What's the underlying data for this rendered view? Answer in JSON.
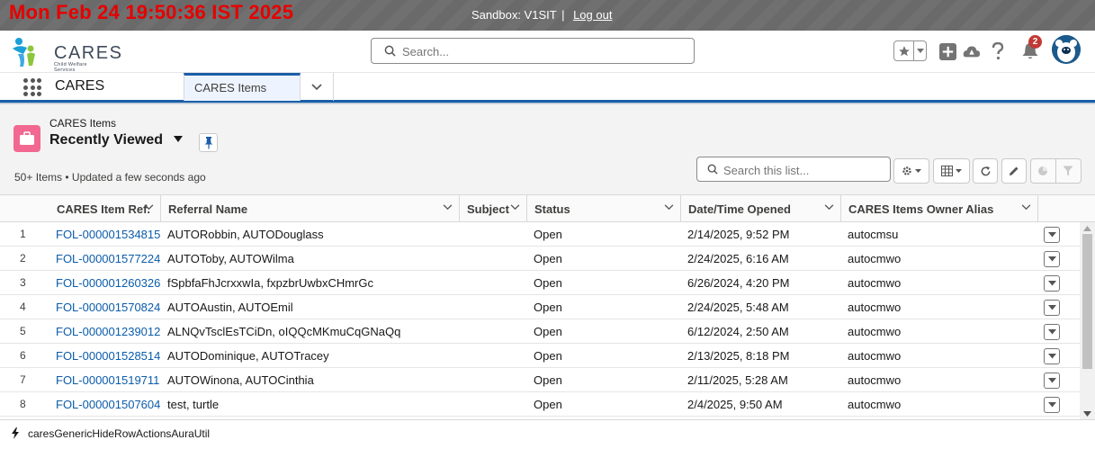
{
  "sandbox": {
    "clock": "Mon Feb 24 19:50:36 IST 2025",
    "label": "Sandbox: V1SIT",
    "separator": "|",
    "logout": "Log out"
  },
  "header": {
    "logo_text": "CARES",
    "logo_sub": "Child Welfare Services",
    "search_placeholder": "Search...",
    "notification_count": "2"
  },
  "nav": {
    "app_name": "CARES",
    "active_tab": "CARES Items"
  },
  "list_view": {
    "object_label": "CARES Items",
    "title": "Recently Viewed",
    "count_text": "50+ Items • Updated a few seconds ago",
    "search_placeholder": "Search this list..."
  },
  "table": {
    "columns": [
      "CARES Item Ref.",
      "Referral Name",
      "Subject",
      "Status",
      "Date/Time Opened",
      "CARES Items Owner Alias"
    ],
    "rows": [
      {
        "num": "1",
        "ref": "FOL-000001534815",
        "referral": "AUTORobbin, AUTODouglass",
        "subject": "",
        "status": "Open",
        "opened": "2/14/2025, 9:52 PM",
        "owner": "autocmsu"
      },
      {
        "num": "2",
        "ref": "FOL-000001577224",
        "referral": "AUTOToby, AUTOWilma",
        "subject": "",
        "status": "Open",
        "opened": "2/24/2025, 6:16 AM",
        "owner": "autocmwo"
      },
      {
        "num": "3",
        "ref": "FOL-000001260326",
        "referral": "fSpbfaFhJcrxxwIa, fxpzbrUwbxCHmrGc",
        "subject": "",
        "status": "Open",
        "opened": "6/26/2024, 4:20 PM",
        "owner": "autocmwo"
      },
      {
        "num": "4",
        "ref": "FOL-000001570824",
        "referral": "AUTOAustin, AUTOEmil",
        "subject": "",
        "status": "Open",
        "opened": "2/24/2025, 5:48 AM",
        "owner": "autocmwo"
      },
      {
        "num": "5",
        "ref": "FOL-000001239012",
        "referral": "ALNQvTsclEsTCiDn, oIQQcMKmuCqGNaQq",
        "subject": "",
        "status": "Open",
        "opened": "6/12/2024, 2:50 AM",
        "owner": "autocmwo"
      },
      {
        "num": "6",
        "ref": "FOL-000001528514",
        "referral": "AUTODominique, AUTOTracey",
        "subject": "",
        "status": "Open",
        "opened": "2/13/2025, 8:18 PM",
        "owner": "autocmwo"
      },
      {
        "num": "7",
        "ref": "FOL-000001519711",
        "referral": "AUTOWinona, AUTOCinthia",
        "subject": "",
        "status": "Open",
        "opened": "2/11/2025, 5:28 AM",
        "owner": "autocmwo"
      },
      {
        "num": "8",
        "ref": "FOL-000001507604",
        "referral": "test, turtle",
        "subject": "",
        "status": "Open",
        "opened": "2/4/2025, 9:50 AM",
        "owner": "autocmwo"
      }
    ]
  },
  "utility_bar": {
    "item": "caresGenericHideRowActionsAuraUtil"
  }
}
